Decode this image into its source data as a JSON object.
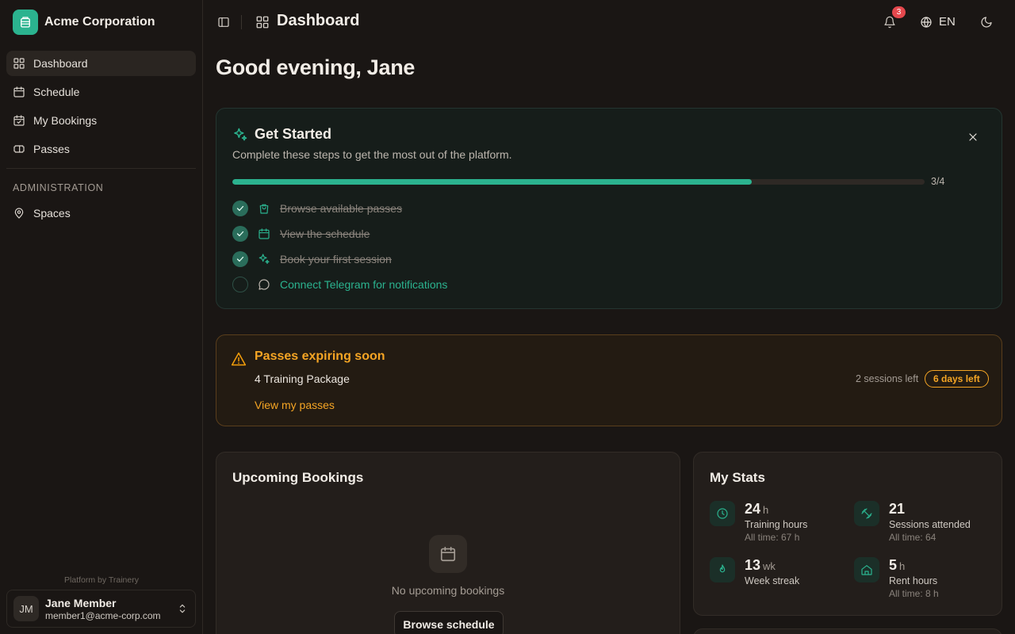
{
  "brand": {
    "name": "Acme Corporation",
    "icon": "building-icon",
    "accent": "#2bb38f"
  },
  "sidebar": {
    "items": [
      {
        "label": "Dashboard",
        "icon": "dashboard-icon",
        "active": true
      },
      {
        "label": "Schedule",
        "icon": "calendar-icon"
      },
      {
        "label": "My Bookings",
        "icon": "calendar-check-icon"
      },
      {
        "label": "Passes",
        "icon": "ticket-icon"
      }
    ],
    "section_title": "ADMINISTRATION",
    "admin_items": [
      {
        "label": "Spaces",
        "icon": "map-pin-icon"
      }
    ],
    "platform_by": "Platform by Trainery",
    "user": {
      "initials": "JM",
      "name": "Jane Member",
      "email": "member1@acme-corp.com"
    }
  },
  "header": {
    "title": "Dashboard",
    "notifications_count": "3",
    "language": "EN"
  },
  "main": {
    "greeting": "Good evening, Jane",
    "get_started": {
      "title": "Get Started",
      "subtitle": "Complete these steps to get the most out of the platform.",
      "progress_text": "3/4",
      "progress_fraction": 0.75,
      "steps": [
        {
          "label": "Browse available passes",
          "done": true,
          "icon": "shopping-bag-icon"
        },
        {
          "label": "View the schedule",
          "done": true,
          "icon": "calendar-icon"
        },
        {
          "label": "Book your first session",
          "done": true,
          "icon": "sparkles-icon"
        },
        {
          "label": "Connect Telegram for notifications",
          "done": false,
          "icon": "message-circle-icon"
        }
      ]
    },
    "expiring": {
      "title": "Passes expiring soon",
      "item": "4 Training Package",
      "sessions_left": "2 sessions left",
      "days_left": "6 days left",
      "link": "View my passes",
      "color": "#f5a524"
    },
    "bookings": {
      "title": "Upcoming Bookings",
      "empty_text": "No upcoming bookings",
      "button": "Browse schedule"
    },
    "stats": {
      "title": "My Stats",
      "items": [
        {
          "value": "24",
          "unit": "h",
          "label": "Training hours",
          "sub": "All time: 67 h",
          "icon": "clock-icon"
        },
        {
          "value": "21",
          "unit": "",
          "label": "Sessions attended",
          "sub": "All time: 64",
          "icon": "dumbbell-icon"
        },
        {
          "value": "13",
          "unit": "wk",
          "label": "Week streak",
          "sub": "",
          "icon": "flame-icon"
        },
        {
          "value": "5",
          "unit": "h",
          "label": "Rent hours",
          "sub": "All time: 8 h",
          "icon": "home-icon"
        }
      ]
    }
  }
}
